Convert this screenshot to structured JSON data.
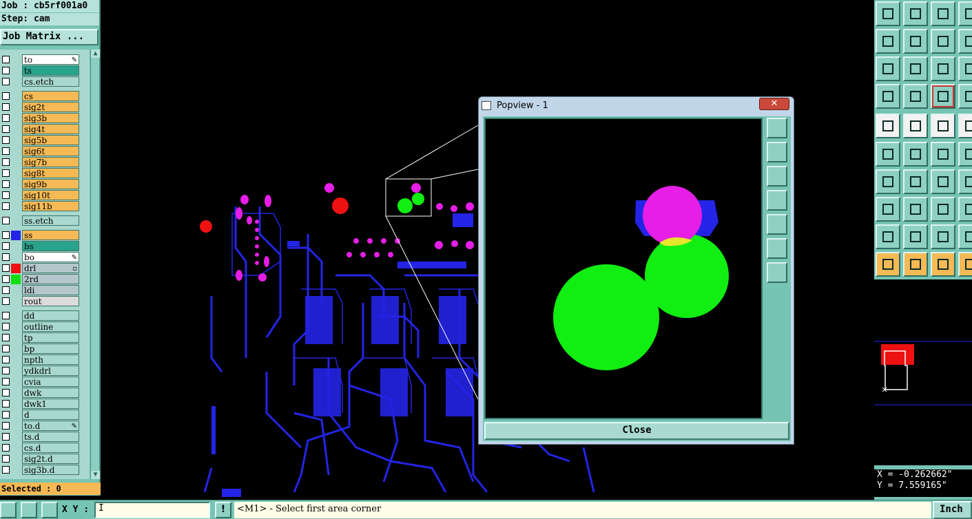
{
  "header": {
    "job_label": "Job : cb5rf001a0",
    "step_label": "Step: cam",
    "job_matrix_button": "Job Matrix ..."
  },
  "layers": [
    {
      "name": "to",
      "color": "#ffffff",
      "mark": "✎"
    },
    {
      "name": "ts",
      "color": "#2aa38c"
    },
    {
      "name": "cs.etch",
      "color": "#a8d8ce"
    },
    {
      "name": "cs",
      "color": "#f5b955"
    },
    {
      "name": "sig2t",
      "color": "#f5b955"
    },
    {
      "name": "sig3b",
      "color": "#f5b955"
    },
    {
      "name": "sig4t",
      "color": "#f5b955"
    },
    {
      "name": "sig5b",
      "color": "#f5b955"
    },
    {
      "name": "sig6t",
      "color": "#f5b955"
    },
    {
      "name": "sig7b",
      "color": "#f5b955"
    },
    {
      "name": "sig8t",
      "color": "#f5b955"
    },
    {
      "name": "sig9b",
      "color": "#f5b955"
    },
    {
      "name": "sig10t",
      "color": "#f5b955"
    },
    {
      "name": "sig11b",
      "color": "#f5b955"
    },
    {
      "name": "ss.etch",
      "color": "#a8d8ce"
    },
    {
      "name": "ss",
      "color": "#f5b955",
      "swatch": "#2424e6"
    },
    {
      "name": "bs",
      "color": "#2aa38c"
    },
    {
      "name": "bo",
      "color": "#ffffff",
      "mark": "✎"
    },
    {
      "name": "drl",
      "color": "#b4c7cc",
      "swatch": "#ee1111",
      "mark": "▫"
    },
    {
      "name": "2rd",
      "color": "#b4c7cc",
      "swatch": "#11dd11"
    },
    {
      "name": "ldi",
      "color": "#b4c7cc"
    },
    {
      "name": "rout",
      "color": "#dcdcdc"
    },
    {
      "name": "dd",
      "color": "#a8d8ce"
    },
    {
      "name": "outline",
      "color": "#a8d8ce"
    },
    {
      "name": "tp",
      "color": "#a8d8ce"
    },
    {
      "name": "bp",
      "color": "#a8d8ce"
    },
    {
      "name": "npth",
      "color": "#a8d8ce"
    },
    {
      "name": "ydkdrl",
      "color": "#a8d8ce"
    },
    {
      "name": "cvia",
      "color": "#a8d8ce"
    },
    {
      "name": "dwk",
      "color": "#a8d8ce"
    },
    {
      "name": "dwk1",
      "color": "#a8d8ce"
    },
    {
      "name": "d",
      "color": "#a8d8ce"
    },
    {
      "name": "to.d",
      "color": "#a8d8ce",
      "mark": "✎"
    },
    {
      "name": "ts.d",
      "color": "#a8d8ce"
    },
    {
      "name": "cs.d",
      "color": "#a8d8ce"
    },
    {
      "name": "sig2t.d",
      "color": "#a8d8ce"
    },
    {
      "name": "sig3b.d",
      "color": "#a8d8ce"
    }
  ],
  "selected_label": "Selected : 0",
  "popview": {
    "title": "Popview - 1",
    "close_x": "✕",
    "close_button": "Close"
  },
  "coords": {
    "x": "X = -0.262662\"",
    "y": "Y = 7.559165\""
  },
  "bottom": {
    "xy_label": "X Y :",
    "xy_value": "I",
    "warn_icon": "!",
    "message": "<M1> - Select first area corner",
    "units": "Inch"
  },
  "colors": {
    "panel": "#76c4b4",
    "pad_blue": "#2424e6",
    "pad_magenta": "#e61ee6",
    "drill_red": "#ee1111",
    "green": "#11ee11"
  }
}
